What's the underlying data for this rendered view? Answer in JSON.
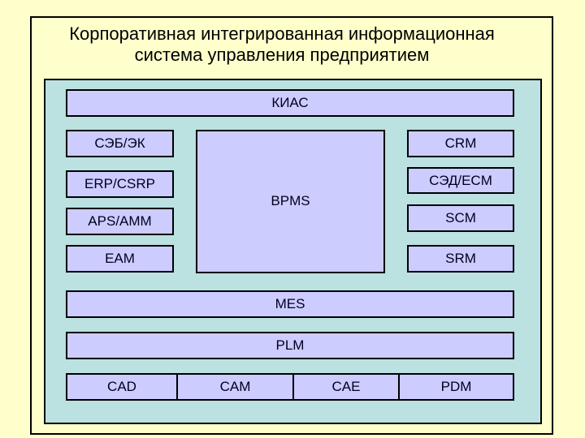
{
  "title": {
    "line1": "Корпоративная интегрированная информационная",
    "line2": "система управления предприятием"
  },
  "colors": {
    "background": "#FFFFCC",
    "panel": "#BBE1E1",
    "module": "#CCCCFF",
    "border": "#000000"
  },
  "top_bar": {
    "label": "КИАС"
  },
  "left_column": [
    {
      "label": "СЭБ/ЭК"
    },
    {
      "label": "ERP/CSRP"
    },
    {
      "label": "APS/AMM"
    },
    {
      "label": "EAM"
    }
  ],
  "center": {
    "label": "BPMS"
  },
  "right_column": [
    {
      "label": "CRM"
    },
    {
      "label": "СЭД/ECM"
    },
    {
      "label": "SCM"
    },
    {
      "label": "SRM"
    }
  ],
  "full_rows": [
    {
      "label": "MES"
    },
    {
      "label": "PLM"
    }
  ],
  "bottom_row": [
    {
      "label": "CAD"
    },
    {
      "label": "CAM"
    },
    {
      "label": "CAE"
    },
    {
      "label": "PDM"
    }
  ]
}
